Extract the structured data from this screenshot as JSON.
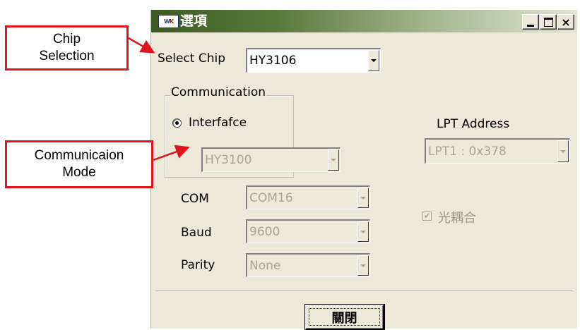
{
  "window": {
    "title": "選項",
    "icon_text_left": "W",
    "icon_text_right": "K",
    "minimize_label": "",
    "close_glyph": "×"
  },
  "chip": {
    "label": "Select Chip",
    "value": "HY3106"
  },
  "communication": {
    "group_label": "Communication",
    "radio_label": "Interfafce",
    "radio_checked": true,
    "interface_value": "HY3100"
  },
  "com": {
    "label": "COM",
    "value": "COM16"
  },
  "baud": {
    "label": "Baud",
    "value": "9600"
  },
  "parity": {
    "label": "Parity",
    "value": "None"
  },
  "lpt": {
    "label": "LPT Address",
    "value": "LPT1 : 0x378"
  },
  "optocoupler": {
    "label": "光耦合",
    "checked": true,
    "check_glyph": "✔"
  },
  "close_button": {
    "label": "關閉"
  },
  "annotations": {
    "chip_selection": [
      "Chip",
      "Selection"
    ],
    "communication_mode": [
      "Communicaion",
      "Mode"
    ]
  },
  "colors": {
    "dialog_bg": "#ece9d8",
    "title_bar_start": "#3c5a22",
    "title_bar_end": "#e1e5d2",
    "disabled_text": "#a8a594",
    "callout_border": "#e0141c"
  }
}
